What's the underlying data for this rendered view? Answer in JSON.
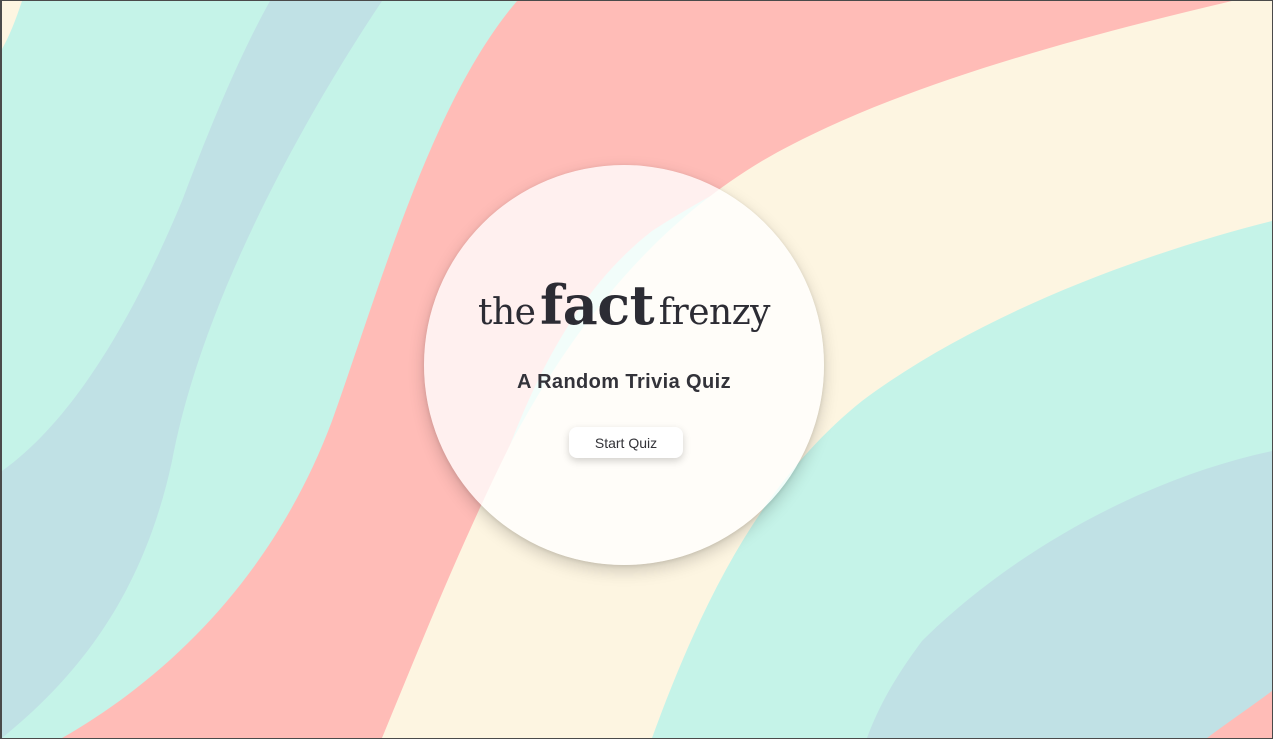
{
  "app": {
    "logo_parts": [
      "the",
      "fact",
      "frenzy"
    ],
    "subtitle": "A Random Trivia Quiz",
    "start_button_label": "Start Quiz"
  },
  "theme": {
    "wave_colors": [
      "#c5f3e8",
      "#c0e1e5",
      "#ffbcb7",
      "#fdf5e1"
    ],
    "text_color": "#2c2c34",
    "button_background": "#ffffff"
  }
}
